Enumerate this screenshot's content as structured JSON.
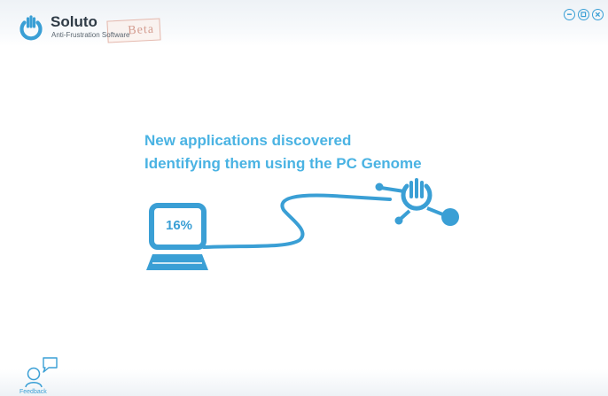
{
  "app": {
    "name": "Soluto",
    "tagline": "Anti-Frustration Software",
    "beta_label": "Beta"
  },
  "window_controls": {
    "minimize_icon": "minimize-circle-icon",
    "maximize_icon": "restore-circle-icon",
    "close_icon": "close-circle-icon"
  },
  "status": {
    "line1": "New applications discovered",
    "line2": "Identifying them using the PC Genome"
  },
  "progress": {
    "percent_label": "16%",
    "value_percent": 16
  },
  "footer": {
    "feedback_label": "Feedback",
    "feedback_icon": "person-speech-bubble-icon"
  },
  "colors": {
    "accent": "#3a9fd5",
    "headline": "#4ab3e3",
    "title_text": "#2f3b46",
    "beta_stamp": "#d49d90"
  }
}
